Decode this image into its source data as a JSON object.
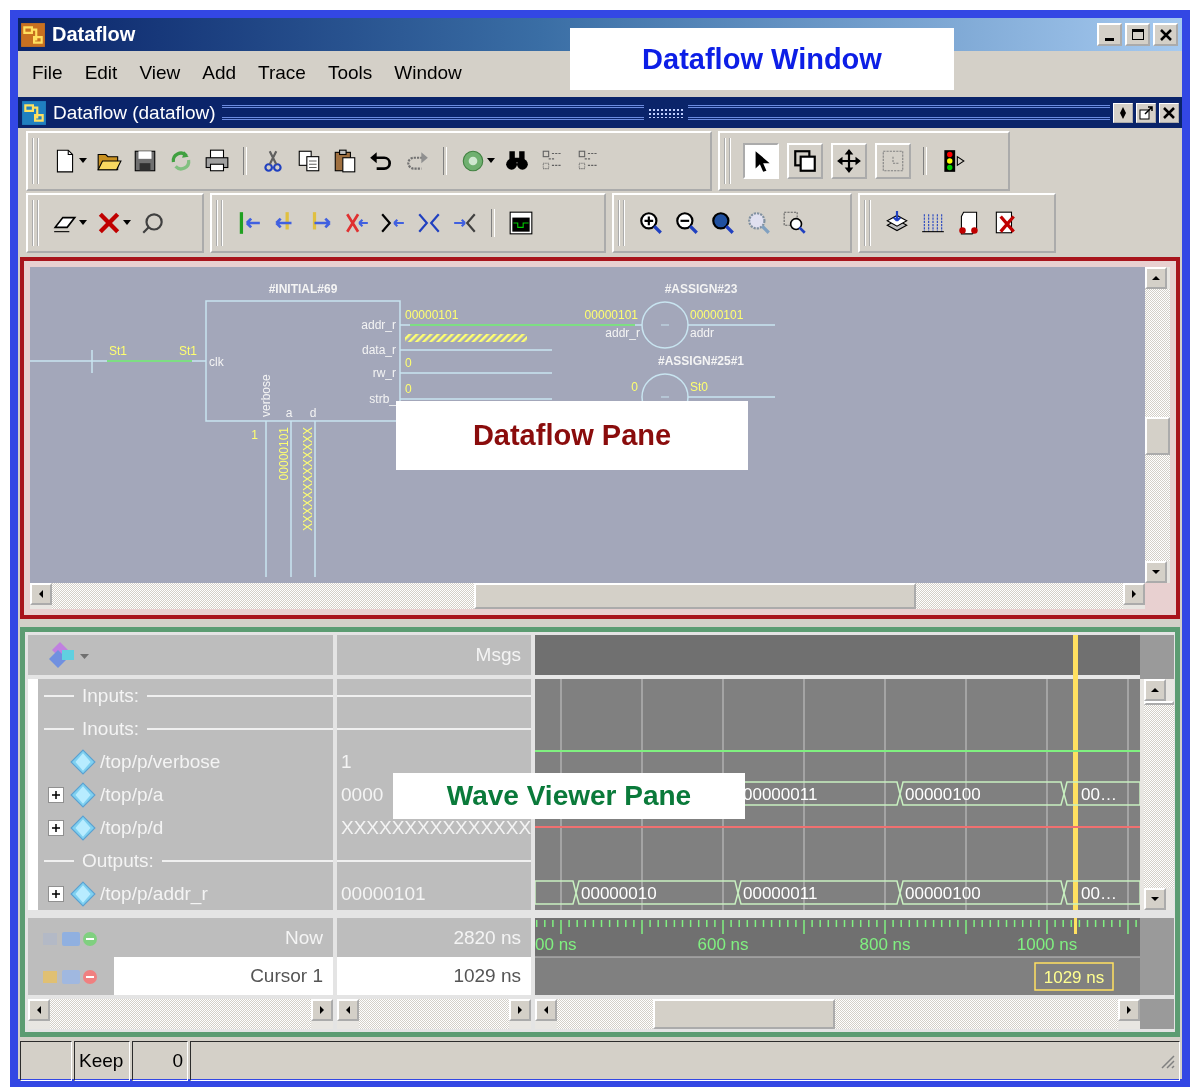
{
  "window": {
    "title": "Dataflow",
    "callout": "Dataflow Window"
  },
  "menu": [
    "File",
    "Edit",
    "View",
    "Add",
    "Trace",
    "Tools",
    "Window"
  ],
  "subwindow": {
    "title": "Dataflow (dataflow)"
  },
  "mode_tools": [
    {
      "kind": "pointer",
      "selected": true
    },
    {
      "kind": "zoom-box",
      "selected": false
    },
    {
      "kind": "move",
      "selected": false
    },
    {
      "kind": "dim-box",
      "selected": false
    }
  ],
  "dataflow_pane": {
    "callout": "Dataflow Pane",
    "diagram": {
      "process": {
        "title": "#INITIAL#69",
        "input_port": "clk",
        "output_ports": [
          "addr_r",
          "data_r",
          "rw_r",
          "strb_"
        ],
        "bottom_ports": [
          "verbose",
          "a",
          "d"
        ]
      },
      "input_values": [
        "St1",
        "St1"
      ],
      "output_values": [
        {
          "kind": "value",
          "text": "00000101"
        },
        {
          "kind": "unknown"
        },
        {
          "kind": "value",
          "text": "0"
        },
        {
          "kind": "value",
          "text": "0"
        }
      ],
      "bottom_values": [
        "1",
        "00000101",
        "XXXXXXXXXXXXX"
      ],
      "assign_nodes": [
        {
          "title": "#ASSIGN#23",
          "input_value": "00000101",
          "input_port": "addr_r",
          "output_value": "00000101",
          "output_port": "addr"
        },
        {
          "title": "#ASSIGN#25#1",
          "input_value": "0",
          "output_value": "St0"
        }
      ]
    }
  },
  "wave_pane": {
    "callout": "Wave Viewer Pane",
    "values_title": "Msgs",
    "rows": [
      {
        "kind": "divider",
        "label": "Inputs:"
      },
      {
        "kind": "divider",
        "label": "Inouts:"
      },
      {
        "kind": "signal",
        "name": "/top/p/verbose",
        "value": "1",
        "expandable": false,
        "wave": {
          "kind": "logic"
        }
      },
      {
        "kind": "signal",
        "name": "/top/p/a",
        "value": "0000",
        "expandable": true,
        "wave": {
          "kind": "bus",
          "segments": [
            "00000011",
            "00000100",
            "00…"
          ]
        }
      },
      {
        "kind": "signal",
        "name": "/top/p/d",
        "value": "XXXXXXXXXXXXXXX",
        "expandable": true,
        "wave": {
          "kind": "unknown"
        }
      },
      {
        "kind": "divider",
        "label": "Outputs:"
      },
      {
        "kind": "signal",
        "name": "/top/p/addr_r",
        "value": "00000101",
        "expandable": true,
        "wave": {
          "kind": "bus",
          "segments": [
            "00000010",
            "00000011",
            "00000100",
            "00…"
          ]
        }
      }
    ],
    "now": {
      "label": "Now",
      "value": "2820 ns"
    },
    "cursor": {
      "label": "Cursor 1",
      "value": "1029 ns",
      "tag": "1029 ns"
    },
    "time_axis": [
      "00 ns",
      "600 ns",
      "800 ns",
      "1000 ns"
    ]
  },
  "status_bar": [
    "Keep",
    "0"
  ]
}
